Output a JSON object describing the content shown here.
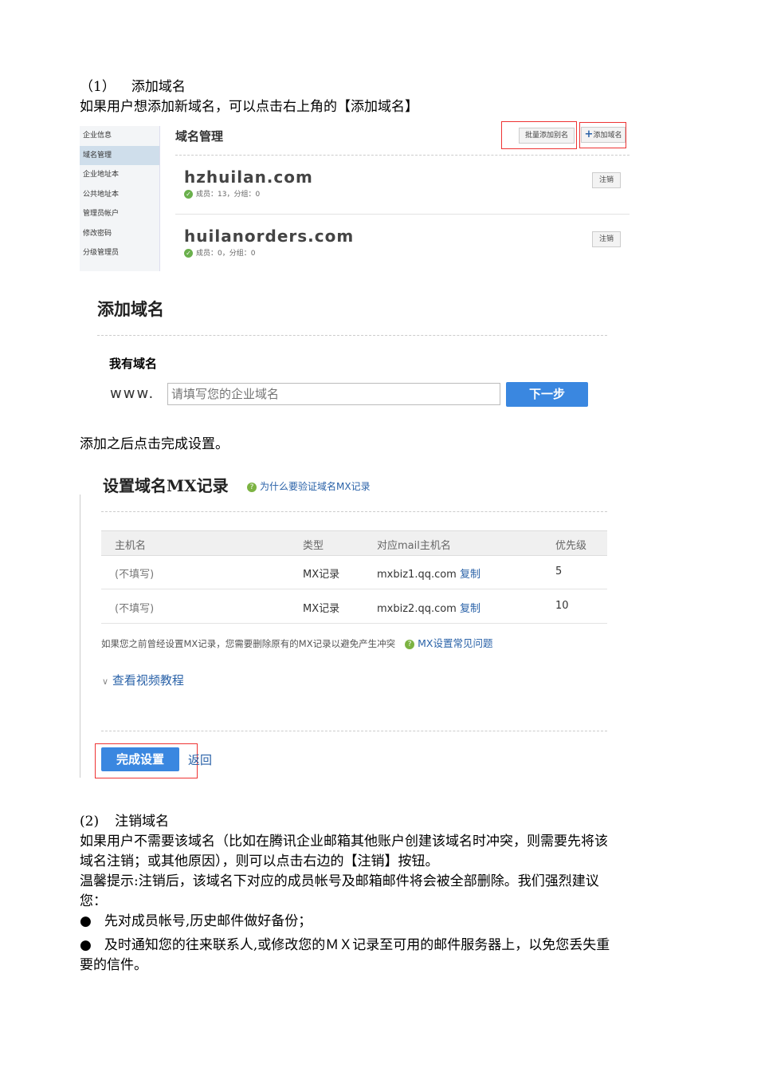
{
  "section1": {
    "heading_num": "（1）",
    "heading": "添加域名",
    "intro": "如果用户想添加新域名，可以点击右上角的【添加域名】"
  },
  "shot1": {
    "sidebar": [
      "企业信息",
      "域名管理",
      "企业地址本",
      "公共地址本",
      "管理员帐户",
      "修改密码",
      "分级管理员"
    ],
    "title": "域名管理",
    "batch_alias": "批量添加别名",
    "add_domain": "添加域名",
    "domains": [
      {
        "name": "hzhuilan.com",
        "stats": "成员：13，分组：0",
        "action": "注销"
      },
      {
        "name": "huilanorders.com",
        "stats": "成员：0，分组：0",
        "action": "注销"
      }
    ]
  },
  "shot2": {
    "title": "添加域名",
    "label": "我有域名",
    "prefix": "www.",
    "placeholder": "请填写您的企业域名",
    "next": "下一步"
  },
  "after_text": "添加之后点击完成设置。",
  "shot3": {
    "title": "设置域名MX记录",
    "why_link": "为什么要验证域名MX记录",
    "headers": [
      "主机名",
      "类型",
      "对应mail主机名",
      "优先级"
    ],
    "rows": [
      {
        "host": "(不填写)",
        "type": "MX记录",
        "mail": "mxbiz1.qq.com",
        "copy": "复制",
        "priority": "5"
      },
      {
        "host": "(不填写)",
        "type": "MX记录",
        "mail": "mxbiz2.qq.com",
        "copy": "复制",
        "priority": "10"
      }
    ],
    "notice": "如果您之前曾经设置MX记录，您需要删除原有的MX记录以避免产生冲突",
    "faq": "MX设置常见问题",
    "video": "查看视频教程",
    "done": "完成设置",
    "back": "返回"
  },
  "section2": {
    "heading_num": "(2)",
    "heading": "注销域名",
    "p1a": "如果用户不需要该域名（比如在腾讯企业邮箱其他账户创建该域名时冲突，则需要先将该",
    "p1b": "域名注销；或其他原因），则可以点击右边的【注销】按钮。",
    "p2a": "温馨提示:注销后，该域名下对应的成员帐号及邮箱邮件将会被全部删除。我们强烈建议",
    "p2b": "您：",
    "bullets": [
      "先对成员帐号,历史邮件做好备份；",
      "及时通知您的往来联系人,或修改您的ＭＸ记录至可用的邮件服务器上，以免您丢失重"
    ],
    "bullet2_cont": "要的信件。"
  }
}
